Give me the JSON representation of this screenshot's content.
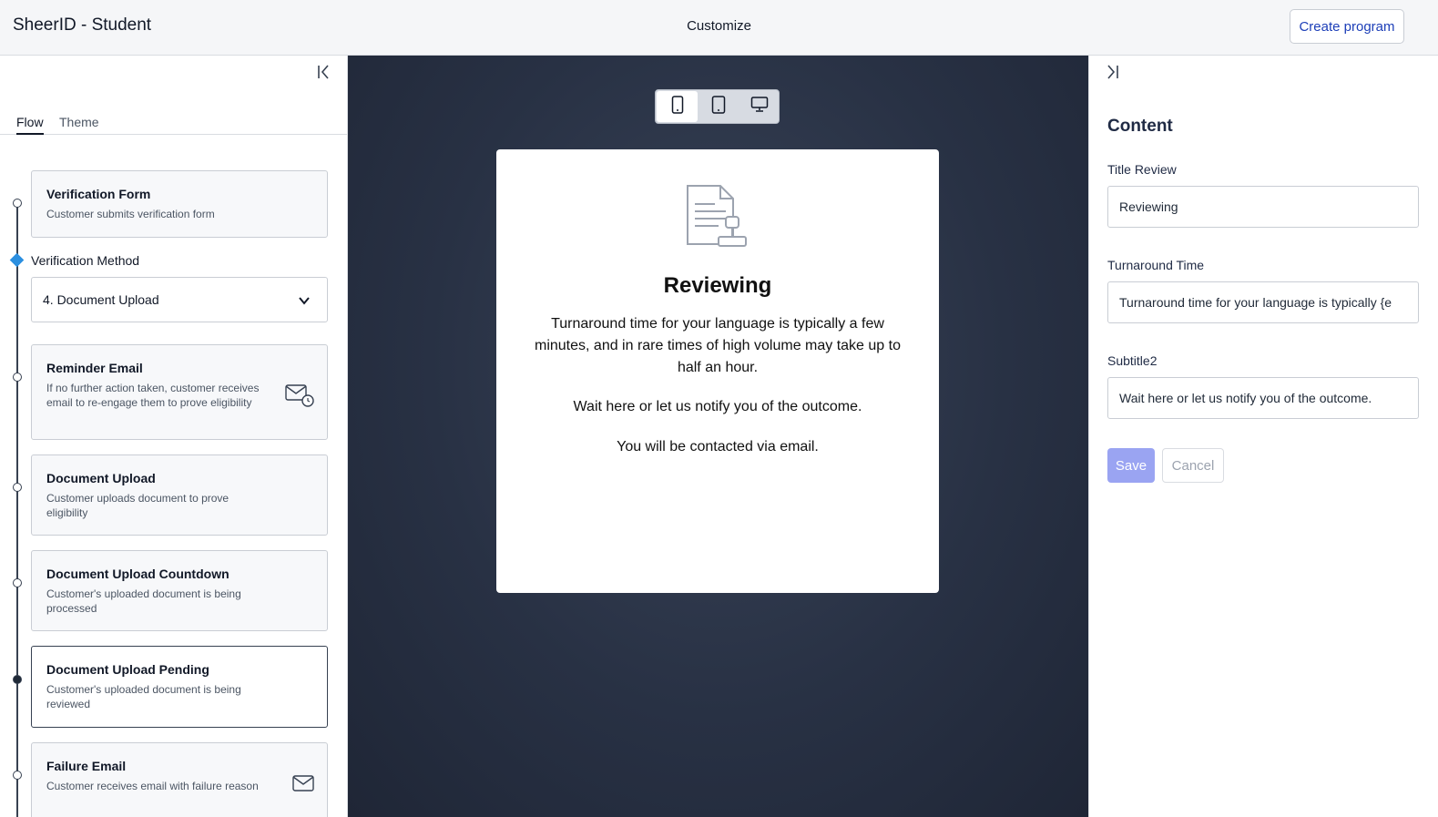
{
  "header": {
    "app_title": "SheerID - Student",
    "center_label": "Customize",
    "create_program_label": "Create program"
  },
  "left_panel": {
    "tabs": [
      {
        "label": "Flow",
        "active": true
      },
      {
        "label": "Theme",
        "active": false
      }
    ],
    "steps": [
      {
        "title": "Verification Form",
        "desc": "Customer submits verification form",
        "icon": null
      },
      {
        "title": "Reminder Email",
        "desc": "If no further action taken, customer receives email to re-engage them to prove eligibility",
        "icon": "email-clock-icon"
      },
      {
        "title": "Document Upload",
        "desc": "Customer uploads document to prove eligibility",
        "icon": null
      },
      {
        "title": "Document Upload Countdown",
        "desc": "Customer's uploaded document is being processed",
        "icon": null
      },
      {
        "title": "Document Upload Pending",
        "desc": "Customer's uploaded document is being reviewed",
        "icon": null,
        "selected": true
      },
      {
        "title": "Failure Email",
        "desc": "Customer receives email with failure reason",
        "icon": "email-icon"
      }
    ],
    "verification_method": {
      "label": "Verification Method",
      "value": "4. Document Upload"
    }
  },
  "preview": {
    "device_modes": [
      "mobile",
      "tablet",
      "desktop"
    ],
    "active_device": "mobile",
    "title": "Reviewing",
    "turnaround_text": "Turnaround time for your language is typically a few minutes, and in rare times of high volume may take up to half an hour.",
    "subtitle2": "Wait here or let us notify you of the outcome.",
    "contact_text": "You will be contacted via email."
  },
  "right_panel": {
    "heading": "Content",
    "fields": [
      {
        "label": "Title Review",
        "value": "Reviewing"
      },
      {
        "label": "Turnaround Time",
        "value": "Turnaround time for your language is typically {e"
      },
      {
        "label": "Subtitle2",
        "value": "Wait here or let us notify you of the outcome."
      }
    ],
    "save_label": "Save",
    "cancel_label": "Cancel"
  },
  "colors": {
    "accent": "#1d3fb8",
    "save_disabled": "#9aa4f2",
    "timeline_active": "#2b8fe0",
    "preview_bg": "#283144"
  }
}
